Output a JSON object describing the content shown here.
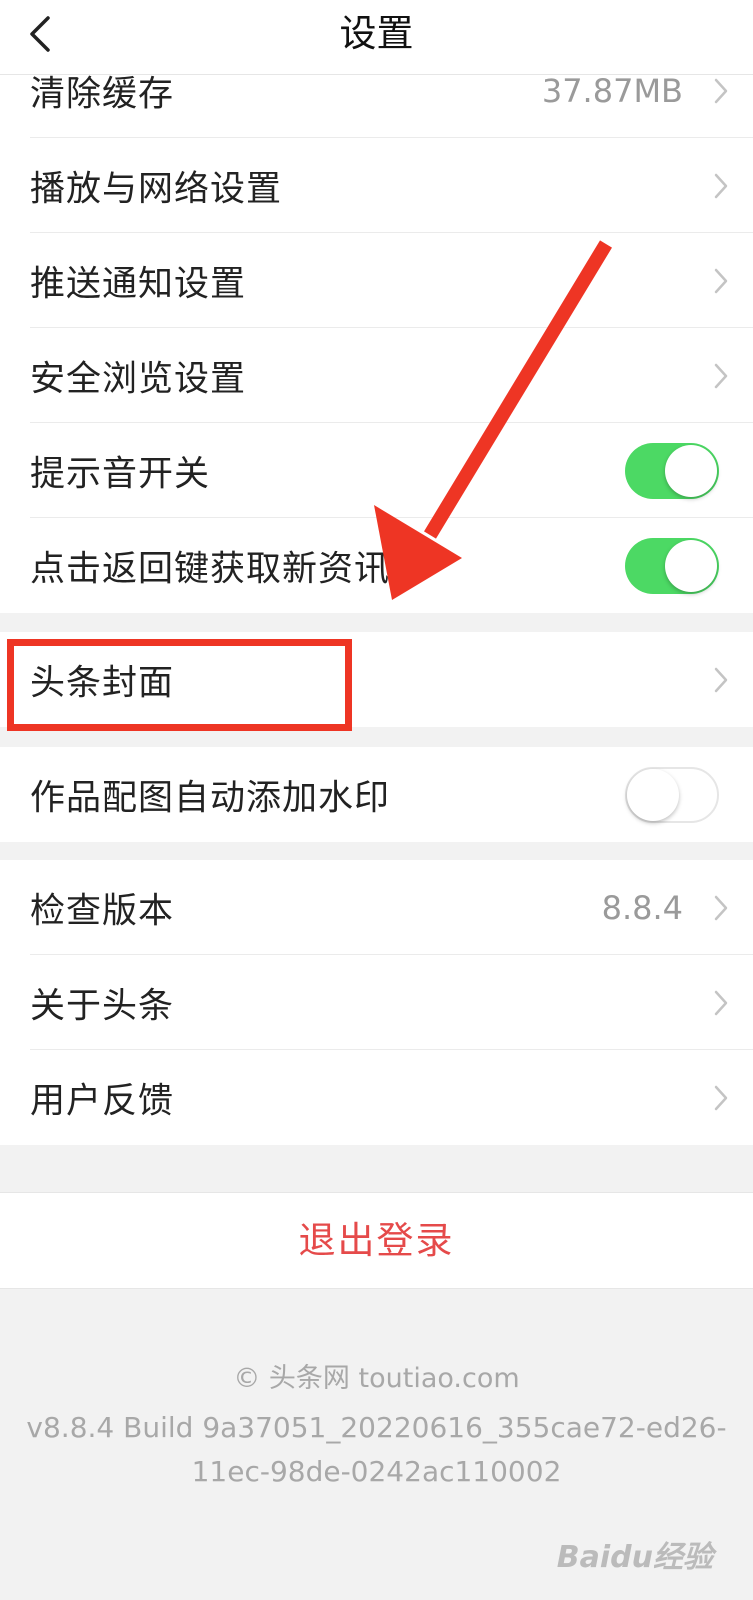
{
  "header": {
    "title": "设置"
  },
  "group1": {
    "rows": [
      {
        "label": "清除缓存",
        "value": "37.87MB"
      },
      {
        "label": "播放与网络设置"
      },
      {
        "label": "推送通知设置"
      },
      {
        "label": "安全浏览设置"
      },
      {
        "label": "提示音开关",
        "toggle": "on"
      },
      {
        "label": "点击返回键获取新资讯",
        "toggle": "on"
      }
    ]
  },
  "group2": {
    "label": "头条封面"
  },
  "group3": {
    "label": "作品配图自动添加水印",
    "toggle": "off"
  },
  "group4": {
    "rows": [
      {
        "label": "检查版本",
        "value": "8.8.4"
      },
      {
        "label": "关于头条"
      },
      {
        "label": "用户反馈"
      }
    ]
  },
  "logout": {
    "label": "退出登录"
  },
  "footer": {
    "copyright": "© 头条网 toutiao.com",
    "build": "v8.8.4 Build 9a37051_20220616_355cae72-ed26-11ec-98de-0242ac110002"
  },
  "watermark": {
    "text": "Baidu经验"
  },
  "colors": {
    "toggle_on": "#4cd964",
    "logout": "#e54a4a",
    "annotation": "#ee3524"
  }
}
